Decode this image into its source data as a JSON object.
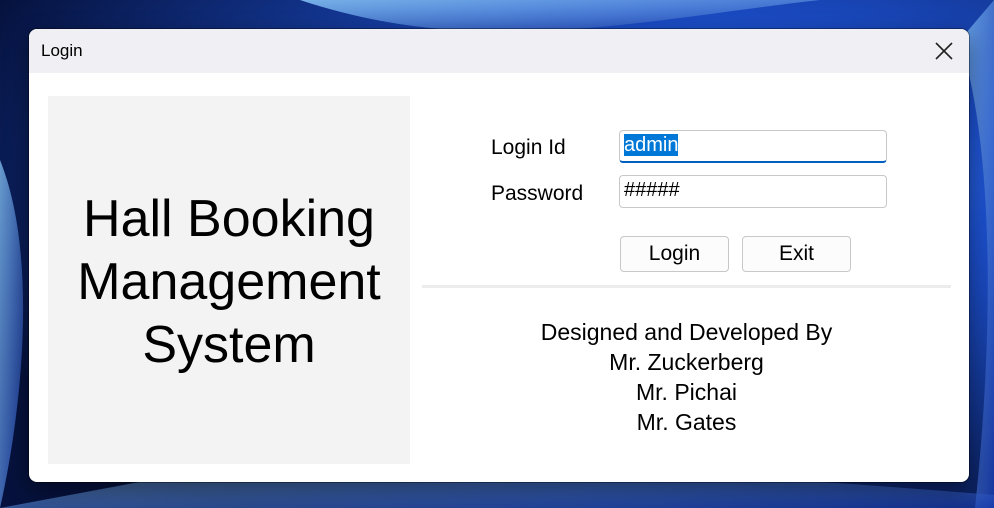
{
  "window": {
    "title": "Login",
    "close_label": "close"
  },
  "branding": {
    "lines": [
      "Hall Booking",
      "Management",
      "System"
    ]
  },
  "form": {
    "login_id_label": "Login Id",
    "login_id_value": "admin",
    "password_label": "Password",
    "password_value": "#####",
    "login_button": "Login",
    "exit_button": "Exit"
  },
  "credits": {
    "heading": "Designed and Developed By",
    "names": [
      "Mr. Zuckerberg",
      "Mr. Pichai",
      "Mr. Gates"
    ]
  },
  "colors": {
    "titlebar": "#f0f0f4",
    "panel": "#f3f3f3",
    "selection": "#0078d7",
    "focus_underline": "#0060c0"
  },
  "icons": {
    "close": "close-icon"
  }
}
